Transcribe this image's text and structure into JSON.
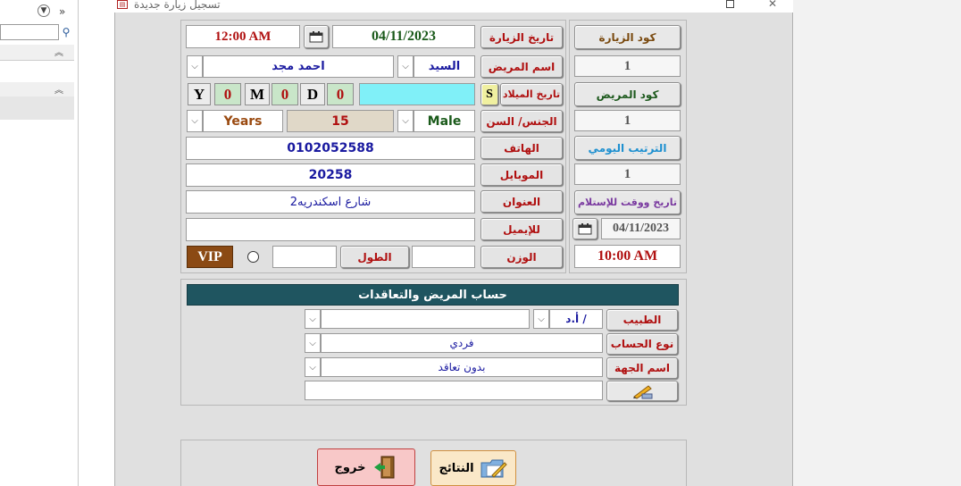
{
  "window": {
    "title": "تسجيل زيارة جديدة"
  },
  "colors": {
    "visit_code": "#7a4a10",
    "patient_code": "#1e5a1e",
    "daily_order": "#1e90d0",
    "receive_time": "#7a3aa0",
    "section_header_bg": "#1f5560",
    "vip_bg": "#8b4a14"
  },
  "visit": {
    "time_value": "12:00 AM",
    "date_value": "04/11/2023",
    "date_label": "تاريخ الزيارة",
    "code_label": "كود الزيارة",
    "code_value": "1"
  },
  "patient": {
    "name_label": "اسم المريض",
    "title_value": "السيد",
    "name_value": "احمد مجد",
    "code_label": "كود المريض",
    "code_value": "1",
    "birth_label": "تاريخ الميلاد",
    "birth_s": "S",
    "birth_value": "",
    "age_y": "Y",
    "age_y_value": "0",
    "age_m": "M",
    "age_m_value": "0",
    "age_d": "D",
    "age_d_value": "0",
    "gender_age_label": "الجنس/ السن",
    "gender_value": "Male",
    "age_value": "15",
    "age_unit": "Years",
    "phone_label": "الهاتف",
    "phone_value": "0102052588",
    "mobile_label": "الموبايل",
    "mobile_value": "20258",
    "address_label": "العنوان",
    "address_value": "شارع اسكندريه2",
    "email_label": "للإيميل",
    "email_value": "",
    "weight_label": "الوزن",
    "weight_value": "",
    "height_label": "الطول",
    "height_value": "",
    "vip_label": "VIP"
  },
  "side": {
    "daily_order_label": "الترتيب اليومي",
    "daily_order_value": "1",
    "receive_label": "تاريخ ووقت للإستلام",
    "receive_date": "04/11/2023",
    "receive_time": "10:00 AM"
  },
  "account": {
    "header": "حساب المريض والتعاقدات",
    "doctor_label": "الطبيب",
    "doctor_prefix": "أ.د /",
    "doctor_value": "",
    "type_label": "نوع الحساب",
    "type_value": "فردي",
    "entity_label": "اسم الجهة",
    "entity_value": "بدون تعاقد",
    "note_value": ""
  },
  "actions": {
    "results_label": "النتائج",
    "exit_label": "خروج"
  },
  "icons": {
    "calendar": "calendar-icon",
    "edit": "pencil-icon",
    "search": "search-icon"
  }
}
